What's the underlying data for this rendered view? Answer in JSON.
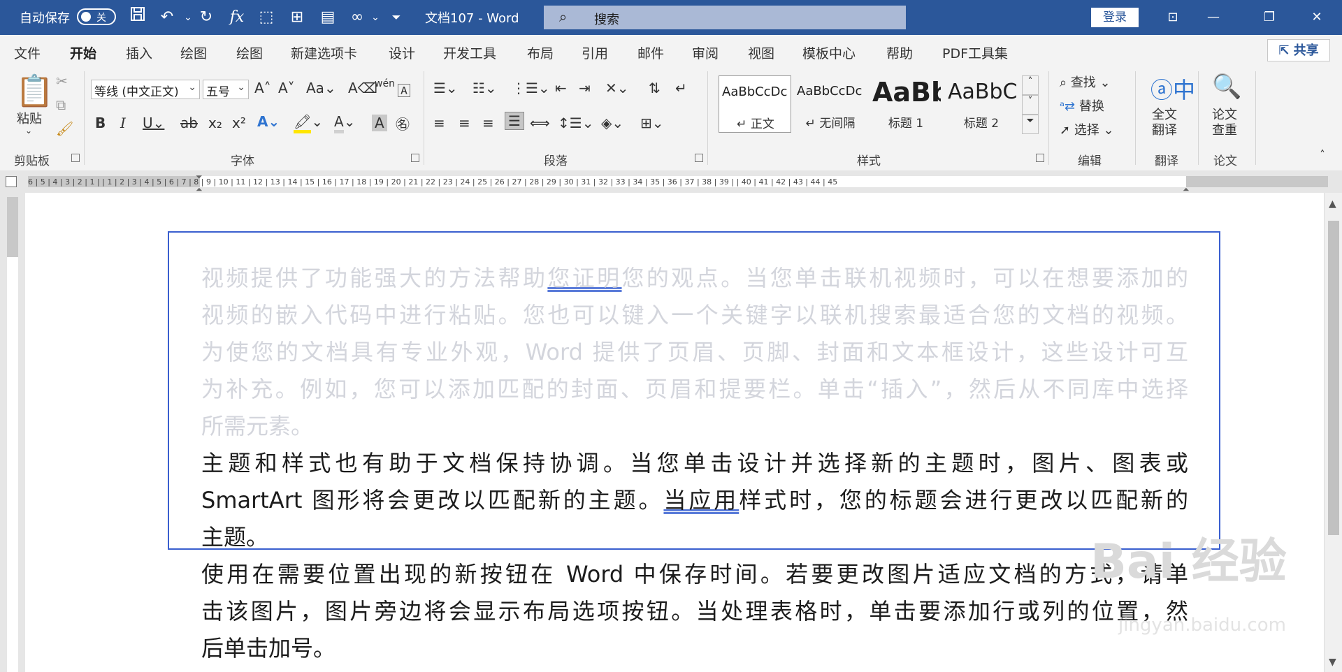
{
  "titlebar": {
    "autosave_label": "自动保存",
    "autosave_state": "关",
    "doc_title": "文档107  -  Word",
    "search_placeholder": "搜索",
    "login_label": "登录"
  },
  "tabs": [
    "文件",
    "开始",
    "插入",
    "绘图",
    "绘图",
    "新建选项卡",
    "设计",
    "开发工具",
    "布局",
    "引用",
    "邮件",
    "审阅",
    "视图",
    "模板中心",
    "帮助",
    "PDF工具集"
  ],
  "active_tab": "开始",
  "share_label": "共享",
  "ribbon": {
    "clipboard": {
      "paste_label": "粘贴",
      "group_label": "剪贴板"
    },
    "font": {
      "font_name": "等线 (中文正文)",
      "font_size": "五号",
      "group_label": "字体"
    },
    "paragraph": {
      "group_label": "段落"
    },
    "styles": {
      "items": [
        {
          "sample": "AaBbCcDc",
          "name": "↵ 正文"
        },
        {
          "sample": "AaBbCcDc",
          "name": "↵ 无间隔"
        },
        {
          "sample": "AaBb",
          "name": "标题 1"
        },
        {
          "sample": "AaBbC",
          "name": "标题 2"
        }
      ],
      "group_label": "样式"
    },
    "editing": {
      "find": "查找",
      "replace": "替换",
      "select": "选择",
      "group_label": "编辑"
    },
    "translate": {
      "label_line1": "全文",
      "label_line2": "翻译",
      "group_label": "翻译"
    },
    "paper": {
      "label_line1": "论文",
      "label_line2": "查重",
      "group_label": "论文"
    }
  },
  "ruler": {
    "numbers": "6 | 5 | 4 | 3 | 2 | 1 |        | 1 | 2 | 3 | 4 | 5 | 6 | 7 | 8 | 9 | 10 | 11 | 12 | 13 | 14 | 15 | 16 | 17 | 18 | 19 | 20 | 21 | 22 | 23 | 24 | 25 | 26 | 27 | 28 | 29 | 30 | 31 | 32 | 33 | 34 | 35 | 36 | 37 | 38 | 39 |    | 40 | 41 | 42 | 43 | 44 | 45"
  },
  "document": {
    "faded_lines": [
      [
        "视频提供了功能强大的方法帮助",
        "您证明",
        "您的观点。当您单击联机视频时，可以在想要添加的"
      ],
      [
        "视频的嵌入代码中进行粘贴。您也可以键入一个关键字以联机搜索最适合您的文档的视频。"
      ],
      [
        "为使您的文档具有专业外观，Word  提供了页眉、页脚、封面和文本框设计，这些设计可互"
      ],
      [
        "为补充。例如，您可以添加匹配的封面、页眉和提要栏。单击“插入”，然后从不同库中选择"
      ],
      [
        "所需元素。"
      ]
    ],
    "dark_lines": [
      [
        "主题和样式也有助于文档保持协调。当您单击设计并选择新的主题时，图片、图表或"
      ],
      [
        "SmartArt  图形将会更改以匹配新的主题。",
        "当应用",
        "样式时，您的标题会进行更改以匹配新的"
      ],
      [
        "主题。"
      ],
      [
        "使用在需要位置出现的新按钮在  Word  中保存时间。若要更改图片适应文档的方式，请单"
      ],
      [
        "击该图片，图片旁边将会显示布局选项按钮。当处理表格时，单击要添加行或列的位置，然"
      ],
      [
        "后单击加号。"
      ]
    ]
  },
  "watermark": {
    "line1": "Bai 经验",
    "line2": "jingyan.baidu.com"
  }
}
